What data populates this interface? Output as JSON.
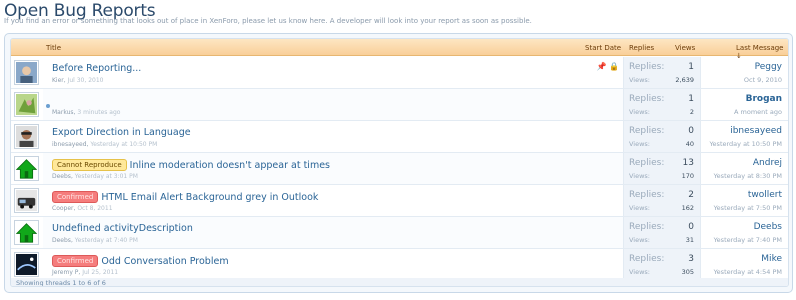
{
  "page": {
    "title": "Open Bug Reports",
    "description": "If you find an error or something that looks out of place in XenForo, please let us know here. A developer will look into your report as soon as possible."
  },
  "columns": {
    "title": "Title",
    "start_date": "Start Date",
    "replies": "Replies",
    "views": "Views",
    "last_message": "Last Message ↓"
  },
  "stat_labels": {
    "replies": "Replies:",
    "views": "Views:"
  },
  "threads": [
    {
      "avatar": "avatar-photo-kier",
      "prefix": "",
      "title": "Before Reporting...",
      "author": "Kier,",
      "date": "Jul 30, 2010",
      "replies": "1",
      "views": "2,639",
      "last_user": "Peggy",
      "last_time": "Oct 9, 2010",
      "sticky": true,
      "locked": true
    },
    {
      "avatar": "avatar-photo-markus",
      "prefix": "",
      "title": "",
      "author": "Markus,",
      "date": "3 minutes ago",
      "replies": "1",
      "views": "2",
      "last_user": "Brogan",
      "last_time": "A moment ago",
      "unread": true
    },
    {
      "avatar": "avatar-photo-ibnesayeed",
      "prefix": "",
      "title": "Export Direction in Language",
      "author": "ibnesayeed,",
      "date": "Yesterday at 10:50 PM",
      "replies": "0",
      "views": "40",
      "last_user": "ibnesayeed",
      "last_time": "Yesterday at 10:50 PM"
    },
    {
      "avatar": "avatar-default-house",
      "prefix": "Cannot Reproduce",
      "prefix_style": "cr",
      "title": "Inline moderation doesn't appear at times",
      "author": "Deebs,",
      "date": "Yesterday at 3:01 PM",
      "replies": "13",
      "views": "170",
      "last_user": "Andrej",
      "last_time": "Yesterday at 8:30 PM"
    },
    {
      "avatar": "avatar-photo-cooper",
      "prefix": "Confirmed",
      "prefix_style": "cf",
      "title": "HTML Email Alert Background grey in Outlook",
      "author": "Cooper,",
      "date": "Oct 8, 2011",
      "replies": "2",
      "views": "162",
      "last_user": "twollert",
      "last_time": "Yesterday at 7:50 PM"
    },
    {
      "avatar": "avatar-default-house",
      "prefix": "",
      "title": "Undefined activityDescription",
      "author": "Deebs,",
      "date": "Yesterday at 7:40 PM",
      "replies": "0",
      "views": "31",
      "last_user": "Deebs",
      "last_time": "Yesterday at 7:40 PM"
    },
    {
      "avatar": "avatar-photo-jeremy",
      "prefix": "Confirmed",
      "prefix_style": "cf",
      "title": "Odd Conversation Problem",
      "author": "Jeremy P,",
      "date": "Jul 25, 2011",
      "replies": "3",
      "views": "305",
      "last_user": "Mike",
      "last_time": "Yesterday at 4:54 PM"
    }
  ],
  "footer": {
    "text": "Showing threads 1 to 6 of 6"
  },
  "colors": {
    "accent": "#2a6496",
    "header_bg": "#f9cf99",
    "prefix_confirmed": "#f57d7d",
    "prefix_cannot_reproduce": "#ffe89a"
  }
}
